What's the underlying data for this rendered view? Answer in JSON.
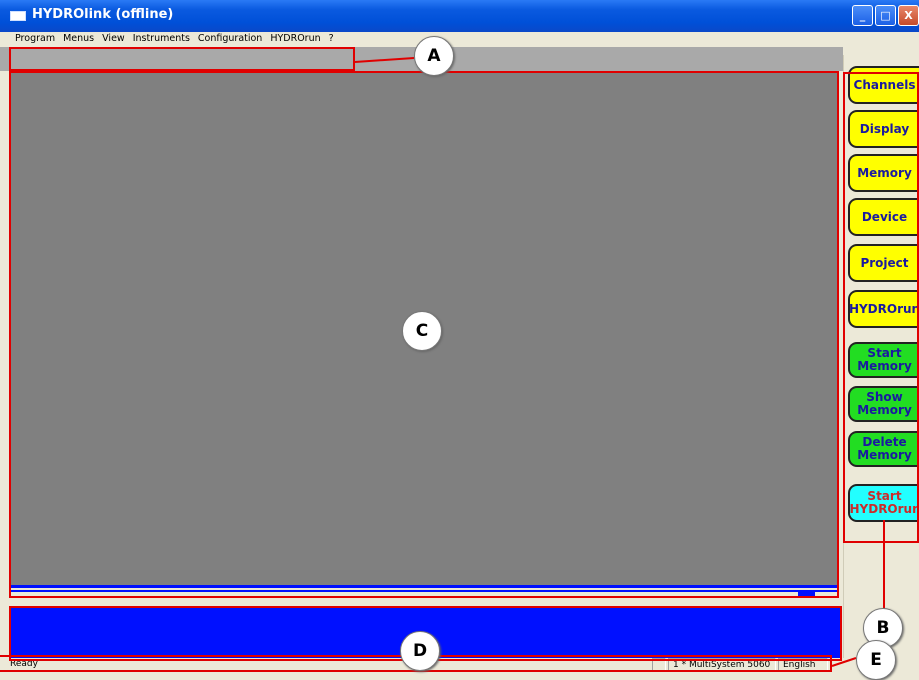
{
  "window": {
    "title": "HYDROlink (offline)",
    "controls": [
      "_",
      "□",
      "X"
    ]
  },
  "menu": [
    "Program",
    "Menus",
    "View",
    "Instruments",
    "Configuration",
    "HYDROrun",
    "?"
  ],
  "side_buttons": [
    {
      "label": "Channels",
      "color": "yellow"
    },
    {
      "label": "Display",
      "color": "yellow"
    },
    {
      "label": "Memory",
      "color": "yellow"
    },
    {
      "label": "Device",
      "color": "yellow"
    },
    {
      "label": "Project",
      "color": "yellow"
    },
    {
      "label": "HYDROrun",
      "color": "yellow"
    },
    {
      "label": "Start Memory",
      "color": "green"
    },
    {
      "label": "Show Memory",
      "color": "green"
    },
    {
      "label": "Delete Memory",
      "color": "green"
    },
    {
      "label": "Start HYDROrun",
      "color": "cyan"
    }
  ],
  "status": {
    "ready": "Ready",
    "device": "1 * MultiSystem 5060",
    "language": "English"
  },
  "callouts": {
    "a": "A",
    "b": "B",
    "c": "C",
    "d": "D",
    "e": "E"
  },
  "colors": {
    "titlebar": "#0050d8",
    "workspace": "#808080",
    "panel_d": "#0010ff",
    "button_yellow": "#ffff00",
    "button_green": "#22dd22",
    "button_cyan": "#22ffff",
    "annotation_red": "#e00000"
  }
}
